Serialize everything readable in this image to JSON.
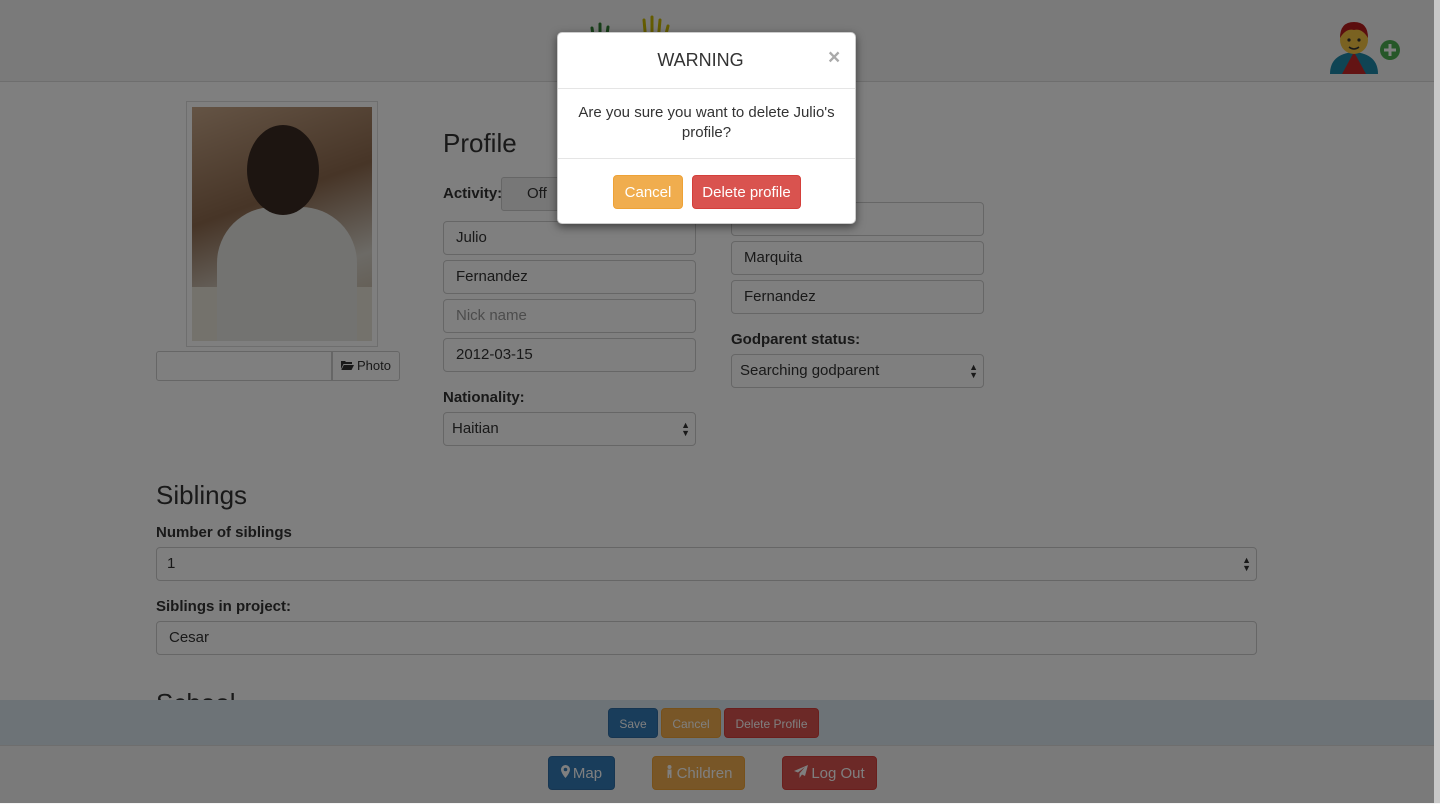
{
  "header": {
    "logo_icon": "hands-logo-icon",
    "add_user_icon": "add-child-icon"
  },
  "photo": {
    "button_label": "Photo",
    "icon": "folder-open-icon"
  },
  "profile": {
    "heading": "Profile",
    "activity_label": "Activity:",
    "activity_toggle": "Off",
    "first_name": "Julio",
    "last_name": "Fernandez",
    "nick_name_placeholder": "Nick name",
    "birth_date": "2012-03-15",
    "nationality_label": "Nationality:",
    "nationality": "Haitian",
    "parent_first_name": "Marquita",
    "parent_last_name": "Fernandez",
    "godparent_status_label": "Godparent status:",
    "godparent_status": "Searching godparent"
  },
  "siblings": {
    "heading": "Siblings",
    "count_label": "Number of siblings",
    "count": "1",
    "in_project_label": "Siblings in project:",
    "in_project": "Cesar"
  },
  "school": {
    "heading": "School"
  },
  "actions": {
    "save": "Save",
    "cancel": "Cancel",
    "delete": "Delete Profile"
  },
  "footer_nav": {
    "map": "Map",
    "map_icon": "map-marker-icon",
    "children": "Children",
    "children_icon": "child-icon",
    "logout": "Log Out",
    "logout_icon": "paper-plane-icon"
  },
  "modal": {
    "title": "WARNING",
    "close": "×",
    "message": "Are you sure you want to delete Julio's profile?",
    "cancel": "Cancel",
    "delete": "Delete profile"
  },
  "colors": {
    "primary": "#337ab7",
    "warning": "#f0ad4e",
    "danger": "#d9534f",
    "action_bar": "#dbe6ee"
  }
}
